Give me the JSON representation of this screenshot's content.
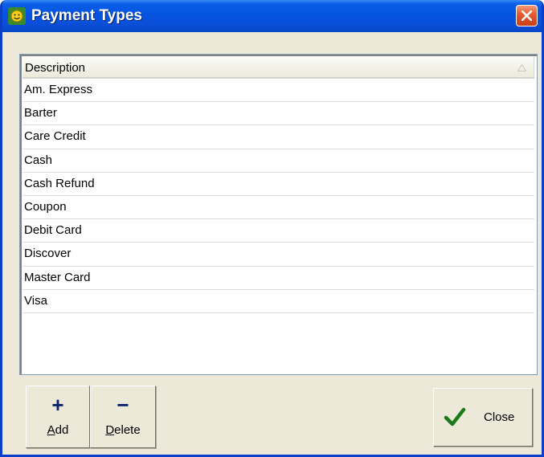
{
  "window": {
    "title": "Payment Types"
  },
  "grid": {
    "column_header": "Description",
    "rows": [
      "Am. Express",
      "Barter",
      "Care Credit",
      "Cash",
      "Cash Refund",
      "Coupon",
      "Debit Card",
      "Discover",
      "Master Card",
      "Visa"
    ]
  },
  "buttons": {
    "add": {
      "symbol": "+",
      "mnemonic": "A",
      "rest": "dd"
    },
    "delete": {
      "symbol": "−",
      "mnemonic": "D",
      "rest": "elete"
    },
    "close": {
      "label": "Close"
    }
  },
  "icons": {
    "app": "sun-icon",
    "title_close": "close-icon",
    "sort": "sort-ascending-icon",
    "close_button": "checkmark-icon"
  },
  "colors": {
    "titlebar": "#0453e0",
    "close_button": "#e2582f",
    "checkmark": "#1a7a1a",
    "add_delete_symbol": "#0a246a"
  }
}
